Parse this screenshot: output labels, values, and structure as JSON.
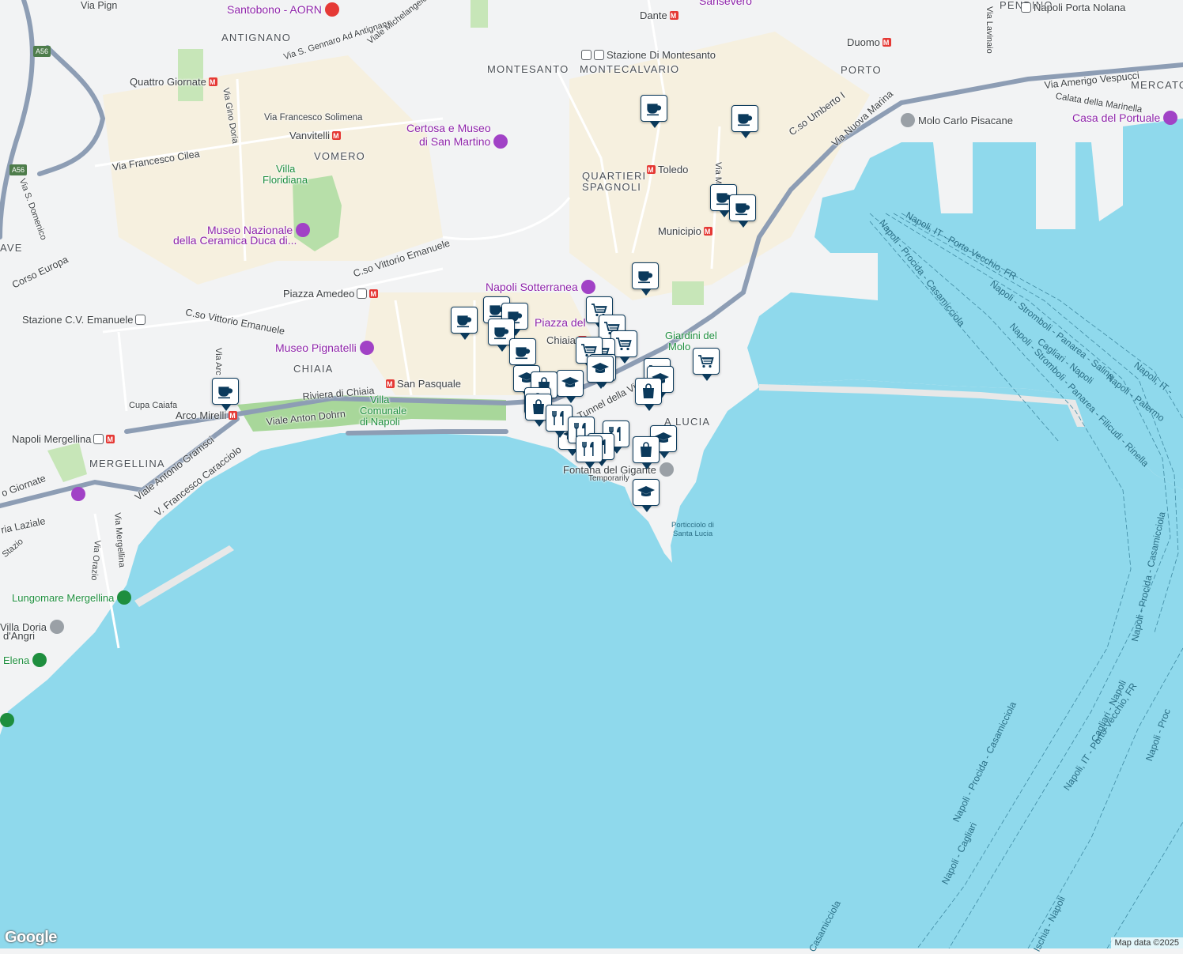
{
  "map": {
    "attribution": "Map data ©2025",
    "logo": "Google",
    "water_color": "#8fd9ec",
    "land_color": "#f2f3f4",
    "park_color": "#b7dfa9",
    "marker_color": "#0b3a5c"
  },
  "neighborhoods": {
    "antignano": "ANTIGNANO",
    "vomero": "VOMERO",
    "montesanto": "MONTESANTO",
    "montecalvario": "MONTECALVARIO",
    "quartieri": "QUARTIERI",
    "spagnoli": "SPAGNOLI",
    "pendino": "PENDINO",
    "porto": "PORTO",
    "mercato": "MERCATO",
    "chiaia": "CHIAIA",
    "mergellina": "MERGELLINA",
    "santa_lucia": "A LUCIA",
    "ave": "AVE"
  },
  "pois": {
    "santobono": "Santobono - AORN",
    "sansevero": "Sansevero",
    "certosa_1": "Certosa e Museo",
    "certosa_2": "di San Martino",
    "villa_floridiana_1": "Villa",
    "villa_floridiana_2": "Floridiana",
    "museo_ceramica_1": "Museo Nazionale",
    "museo_ceramica_2": "della Ceramica Duca di...",
    "napoli_sotterranea": "Napoli Sotterranea",
    "piazza_plebiscito": "Piazza del",
    "museo_pignatelli": "Museo Pignatelli",
    "villa_comunale_1": "Villa",
    "villa_comunale_2": "Comunale",
    "villa_comunale_3": "di Napoli",
    "giardini_molo_1": "Giardini del",
    "giardini_molo_2": "Molo",
    "fontana_gigante": "Fontana del Gigante",
    "temporarily": "Temporarily",
    "porticciolo_1": "Porticciolo di",
    "porticciolo_2": "Santa Lucia",
    "molo_pisacane": "Molo Carlo Pisacane",
    "casa_portuale": "Casa del Portuale",
    "lungomare": "Lungomare Mergellina",
    "villa_doria_1": "Villa Doria",
    "villa_doria_2": "d'Angri",
    "elena": "Elena"
  },
  "stations": {
    "dante": "Dante",
    "montesanto": "Stazione Di Montesanto",
    "duomo": "Duomo",
    "porta_nolana": "Napoli Porta Nolana",
    "quattro_giornate": "Quattro Giornate",
    "vanvitelli": "Vanvitelli",
    "toledo": "Toledo",
    "municipio": "Municipio",
    "piazza_amedeo": "Piazza Amedeo",
    "cv_emanuele": "Stazione C.V. Emanuele",
    "chiaia": "Chiaia",
    "san_pasquale": "San Pasquale",
    "arco_mirelli": "Arco Mirelli",
    "mergellina": "Napoli Mergellina"
  },
  "roads": {
    "via_pigna": "Via Pign",
    "via_gennaro": "Via S. Gennaro Ad Antignano",
    "via_michelangelo": "Viale Michelangelo",
    "via_solimena": "Via Francesco Solimena",
    "via_cilea": "Via Francesco Cilea",
    "via_gino_doria": "Via Gino Doria",
    "via_domenico": "Via S. Domenico",
    "corso_europa": "Corso Europa",
    "cso_ve_1": "C.so Vittorio Emanuele",
    "cso_ve_2": "C.so Vittorio Emanuele",
    "via_arco": "Via Arc",
    "riviera": "Riviera di Chiaia",
    "anton_dohrn": "Viale Anton Dohrn",
    "cupa_caiafa": "Cupa Caiafa",
    "gramsci": "Viale Antonio Gramsci",
    "caracciolo": "V. Francesco Caracciolo",
    "via_mergellina": "Via Mergellina",
    "via_orazio": "Via Orazio",
    "giornate": "o Giornate",
    "laziale": "ria Laziale",
    "stazio": "Stazio",
    "tunnel": "Tunnel della Vittoria",
    "cso_umberto": "C.so Umberto I",
    "nuova_marina": "Via Nuova Marina",
    "vespucci": "Via Amerigo Vespucci",
    "calata": "Calata della Marinella",
    "via_lavinaio": "Via Lavinaio",
    "via_medina": "Via Medina",
    "a56": "A56"
  },
  "ferry_routes": {
    "porto_vecchio": "Napoli, IT - Porto-Vecchio, FR",
    "procida_casamicciola": "Napoli - Procida - Casamicciola",
    "stromboli_salina": "Napoli - Stromboli - Panarea - Salina",
    "cagliari": "Cagliari - Napoli",
    "palermo": "Napoli - Palermo",
    "filicudi": "Napoli - Stromboli - Panarea - Filicudi - Rinella",
    "napoli_it": "Napoli, IT -",
    "east_casamicciola": "Napoli - Procida - Casamicciola",
    "east_cagliari": "Cagliari - Napoli",
    "east_porto_vecchio": "Napoli, IT - Porto-Vecchio, FR",
    "south_procida": "Napoli - Procida - Casamicciola",
    "south_cagliari": "Napoli - Cagliari",
    "ischia": "Ischia - Napoli",
    "casamicciola": "Casamicciola",
    "far_right": "Napoli - Proc"
  },
  "markers": [
    {
      "type": "cafe"
    },
    {
      "type": "cafe"
    },
    {
      "type": "cafe"
    },
    {
      "type": "cafe"
    },
    {
      "type": "cafe"
    },
    {
      "type": "cafe"
    },
    {
      "type": "cafe"
    },
    {
      "type": "cafe"
    },
    {
      "type": "cafe"
    },
    {
      "type": "cafe"
    },
    {
      "type": "cafe"
    },
    {
      "type": "shopping-cart"
    },
    {
      "type": "shopping-cart"
    },
    {
      "type": "shopping-cart"
    },
    {
      "type": "shopping-cart"
    },
    {
      "type": "shopping-cart"
    },
    {
      "type": "shopping-cart"
    },
    {
      "type": "shopping-cart"
    },
    {
      "type": "shopping-cart"
    },
    {
      "type": "school"
    },
    {
      "type": "school"
    },
    {
      "type": "school"
    },
    {
      "type": "school"
    },
    {
      "type": "school"
    },
    {
      "type": "school"
    },
    {
      "type": "school"
    },
    {
      "type": "shopping-bag"
    },
    {
      "type": "shopping-bag"
    },
    {
      "type": "shopping-bag"
    },
    {
      "type": "shopping-bag"
    },
    {
      "type": "shopping-bag"
    },
    {
      "type": "restaurant"
    },
    {
      "type": "restaurant"
    },
    {
      "type": "restaurant"
    },
    {
      "type": "restaurant"
    },
    {
      "type": "restaurant"
    }
  ]
}
